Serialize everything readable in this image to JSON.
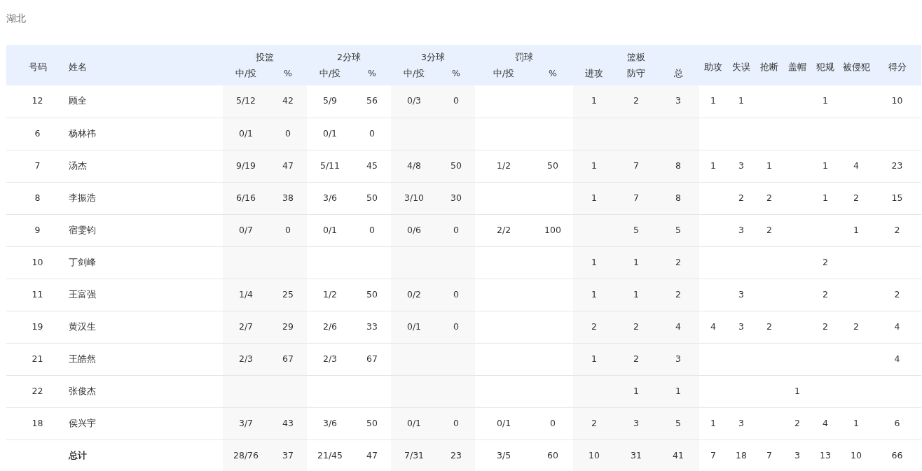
{
  "team": "湖北",
  "header_groups": [
    {
      "label": "号码"
    },
    {
      "label": "姓名"
    },
    {
      "label": "投篮",
      "sub": [
        "中/投",
        "%"
      ]
    },
    {
      "label": "2分球",
      "sub": [
        "中/投",
        "%"
      ]
    },
    {
      "label": "3分球",
      "sub": [
        "中/投",
        "%"
      ]
    },
    {
      "label": "罚球",
      "sub": [
        "中/投",
        "%"
      ]
    },
    {
      "label": "篮板",
      "sub": [
        "进攻",
        "防守",
        "总"
      ]
    },
    {
      "label": "助攻"
    },
    {
      "label": "失误"
    },
    {
      "label": "抢断"
    },
    {
      "label": "盖帽"
    },
    {
      "label": "犯规"
    },
    {
      "label": "被侵犯"
    },
    {
      "label": "得分"
    }
  ],
  "rows": [
    {
      "kind": "player",
      "cells": [
        "12",
        "顾全",
        "5/12",
        "42",
        "5/9",
        "56",
        "0/3",
        "0",
        null,
        null,
        "1",
        "2",
        "3",
        "1",
        "1",
        null,
        null,
        "1",
        null,
        "10"
      ]
    },
    {
      "kind": "player",
      "cells": [
        "6",
        "杨林祎",
        "0/1",
        "0",
        "0/1",
        "0",
        null,
        null,
        null,
        null,
        null,
        null,
        null,
        null,
        null,
        null,
        null,
        null,
        null,
        null
      ]
    },
    {
      "kind": "player",
      "cells": [
        "7",
        "汤杰",
        "9/19",
        "47",
        "5/11",
        "45",
        "4/8",
        "50",
        "1/2",
        "50",
        "1",
        "7",
        "8",
        "1",
        "3",
        "1",
        null,
        "1",
        "4",
        "23"
      ]
    },
    {
      "kind": "player",
      "cells": [
        "8",
        "李振浩",
        "6/16",
        "38",
        "3/6",
        "50",
        "3/10",
        "30",
        null,
        null,
        "1",
        "7",
        "8",
        null,
        "2",
        "2",
        null,
        "1",
        "2",
        "15"
      ]
    },
    {
      "kind": "player",
      "cells": [
        "9",
        "宿雯钧",
        "0/7",
        "0",
        "0/1",
        "0",
        "0/6",
        "0",
        "2/2",
        "100",
        null,
        "5",
        "5",
        null,
        "3",
        "2",
        null,
        null,
        "1",
        "2"
      ]
    },
    {
      "kind": "player",
      "cells": [
        "10",
        "丁剑峰",
        null,
        null,
        null,
        null,
        null,
        null,
        null,
        null,
        "1",
        "1",
        "2",
        null,
        null,
        null,
        null,
        "2",
        null,
        null
      ]
    },
    {
      "kind": "player",
      "cells": [
        "11",
        "王富强",
        "1/4",
        "25",
        "1/2",
        "50",
        "0/2",
        "0",
        null,
        null,
        "1",
        "1",
        "2",
        null,
        "3",
        null,
        null,
        "2",
        null,
        "2"
      ]
    },
    {
      "kind": "player",
      "cells": [
        "19",
        "黄汉生",
        "2/7",
        "29",
        "2/6",
        "33",
        "0/1",
        "0",
        null,
        null,
        "2",
        "2",
        "4",
        "4",
        "3",
        "2",
        null,
        "2",
        "2",
        "4"
      ]
    },
    {
      "kind": "player",
      "cells": [
        "21",
        "王皓然",
        "2/3",
        "67",
        "2/3",
        "67",
        null,
        null,
        null,
        null,
        "1",
        "2",
        "3",
        null,
        null,
        null,
        null,
        null,
        null,
        "4"
      ]
    },
    {
      "kind": "player",
      "cells": [
        "22",
        "张俊杰",
        null,
        null,
        null,
        null,
        null,
        null,
        null,
        null,
        null,
        "1",
        "1",
        null,
        null,
        null,
        "1",
        null,
        null,
        null
      ]
    },
    {
      "kind": "player",
      "cells": [
        "18",
        "侯兴宇",
        "3/7",
        "43",
        "3/6",
        "50",
        "0/1",
        "0",
        "0/1",
        "0",
        "2",
        "3",
        "5",
        "1",
        "3",
        null,
        "2",
        "4",
        "1",
        "6"
      ]
    },
    {
      "kind": "total",
      "cells": [
        null,
        "总计",
        "28/76",
        "37",
        "21/45",
        "47",
        "7/31",
        "23",
        "3/5",
        "60",
        "10",
        "31",
        "41",
        "7",
        "18",
        "7",
        "3",
        "13",
        "10",
        "66"
      ]
    }
  ]
}
